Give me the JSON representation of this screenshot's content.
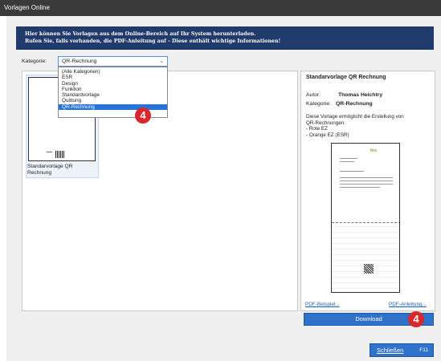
{
  "window": {
    "title": "Vorlagen Online"
  },
  "banner": {
    "line1": "Hier können Sie Vorlagen aus dem Online-Bereich auf Ihr System herunterladen.",
    "line2": "Rufen Sie, falls vorhanden, die PDF-Anleitung auf - Diese enthält wichtige Informationen!"
  },
  "category": {
    "label": "Kategorie:",
    "selected": "QR-Rechnung",
    "options": [
      "(Alle Kategorien)",
      "ESR",
      "Design",
      "Funktion",
      "Standardvorlage",
      "Quittung",
      "QR-Rechnung"
    ],
    "selected_index": 6
  },
  "templates": [
    {
      "name": "Standarvorlage QR Rechnung"
    }
  ],
  "details": {
    "title": "Standarvorlage QR Rechnung",
    "author_label": "Autor:",
    "author": "Thomas Heichtry",
    "category_label": "Kategorie:",
    "category": "QR-Rechnung",
    "description": [
      "Diese Vorlage ermöglicht die Erstellung von",
      "QR-Rechnungen:",
      "- Rote EZ",
      "- Orange EZ (ESR)"
    ],
    "preview_logo": "ltra",
    "pdf_example": "PDF-Beispiel...",
    "pdf_manual": "PDF-Anleitung..."
  },
  "buttons": {
    "download": "Download",
    "close": "Schließen",
    "close_key": "F11"
  },
  "badges": {
    "dropdown": "4",
    "download": "4"
  },
  "colors": {
    "banner": "#1f3a6b",
    "accent": "#2f72c9",
    "badge": "#d9272e",
    "selection": "#2673d9"
  }
}
